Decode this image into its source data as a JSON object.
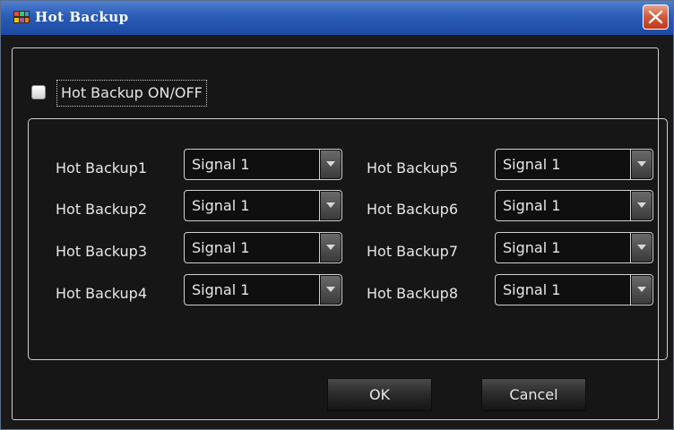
{
  "window": {
    "title": "Hot Backup",
    "close_label": "X"
  },
  "checkbox": {
    "label": "Hot Backup ON/OFF",
    "checked": false
  },
  "backups": [
    {
      "label": "Hot Backup1",
      "value": "Signal 1"
    },
    {
      "label": "Hot Backup2",
      "value": "Signal 1"
    },
    {
      "label": "Hot Backup3",
      "value": "Signal 1"
    },
    {
      "label": "Hot Backup4",
      "value": "Signal 1"
    },
    {
      "label": "Hot Backup5",
      "value": "Signal 1"
    },
    {
      "label": "Hot Backup6",
      "value": "Signal 1"
    },
    {
      "label": "Hot Backup7",
      "value": "Signal 1"
    },
    {
      "label": "Hot Backup8",
      "value": "Signal 1"
    }
  ],
  "buttons": {
    "ok": "OK",
    "cancel": "Cancel"
  },
  "colors": {
    "titlebar": "#2a5cb6",
    "background": "#191919",
    "close": "#d2583a"
  }
}
